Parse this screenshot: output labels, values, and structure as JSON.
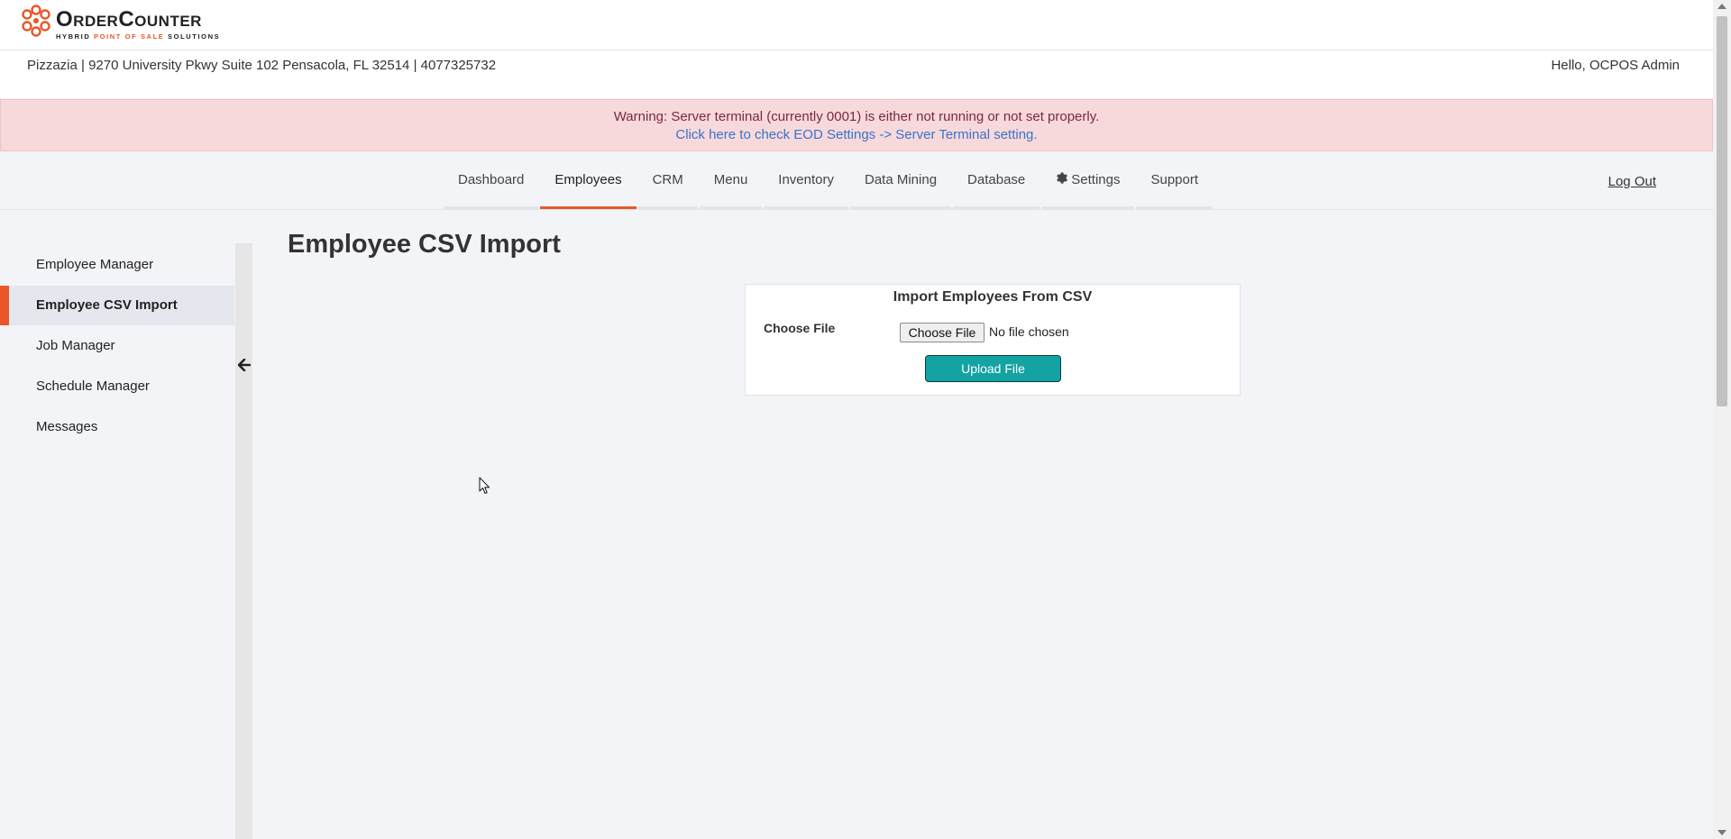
{
  "brand": {
    "name": "OrderCounter",
    "tagline_start": "HYBRID ",
    "tagline_accent": "POINT OF SALE",
    "tagline_end": " SOLUTIONS",
    "accent_color": "#e8572a"
  },
  "store": {
    "info": "Pizzazia | 9270 University Pkwy Suite 102 Pensacola, FL 32514 | 4077325732",
    "greeting": "Hello, OCPOS Admin"
  },
  "alert": {
    "message": "Warning: Server terminal (currently 0001) is either not running or not set properly.",
    "link": "Click here to check EOD Settings -> Server Terminal setting."
  },
  "nav": {
    "items": [
      {
        "label": "Dashboard"
      },
      {
        "label": "Employees",
        "active": true
      },
      {
        "label": "CRM"
      },
      {
        "label": "Menu"
      },
      {
        "label": "Inventory"
      },
      {
        "label": "Data Mining"
      },
      {
        "label": "Database"
      },
      {
        "label": "Settings",
        "icon": "gear-icon"
      },
      {
        "label": "Support"
      }
    ],
    "logout": "Log Out"
  },
  "sidebar": {
    "items": [
      {
        "label": "Employee Manager"
      },
      {
        "label": "Employee CSV Import",
        "active": true
      },
      {
        "label": "Job Manager"
      },
      {
        "label": "Schedule Manager"
      },
      {
        "label": "Messages"
      }
    ],
    "collapse_icon": "arrow-left-icon"
  },
  "main": {
    "title": "Employee CSV Import",
    "card": {
      "title": "Import Employees From CSV",
      "choose_label": "Choose File",
      "file_button": "Choose File",
      "file_status": "No file chosen",
      "upload_button": "Upload File",
      "upload_color": "#13a3a3"
    }
  }
}
